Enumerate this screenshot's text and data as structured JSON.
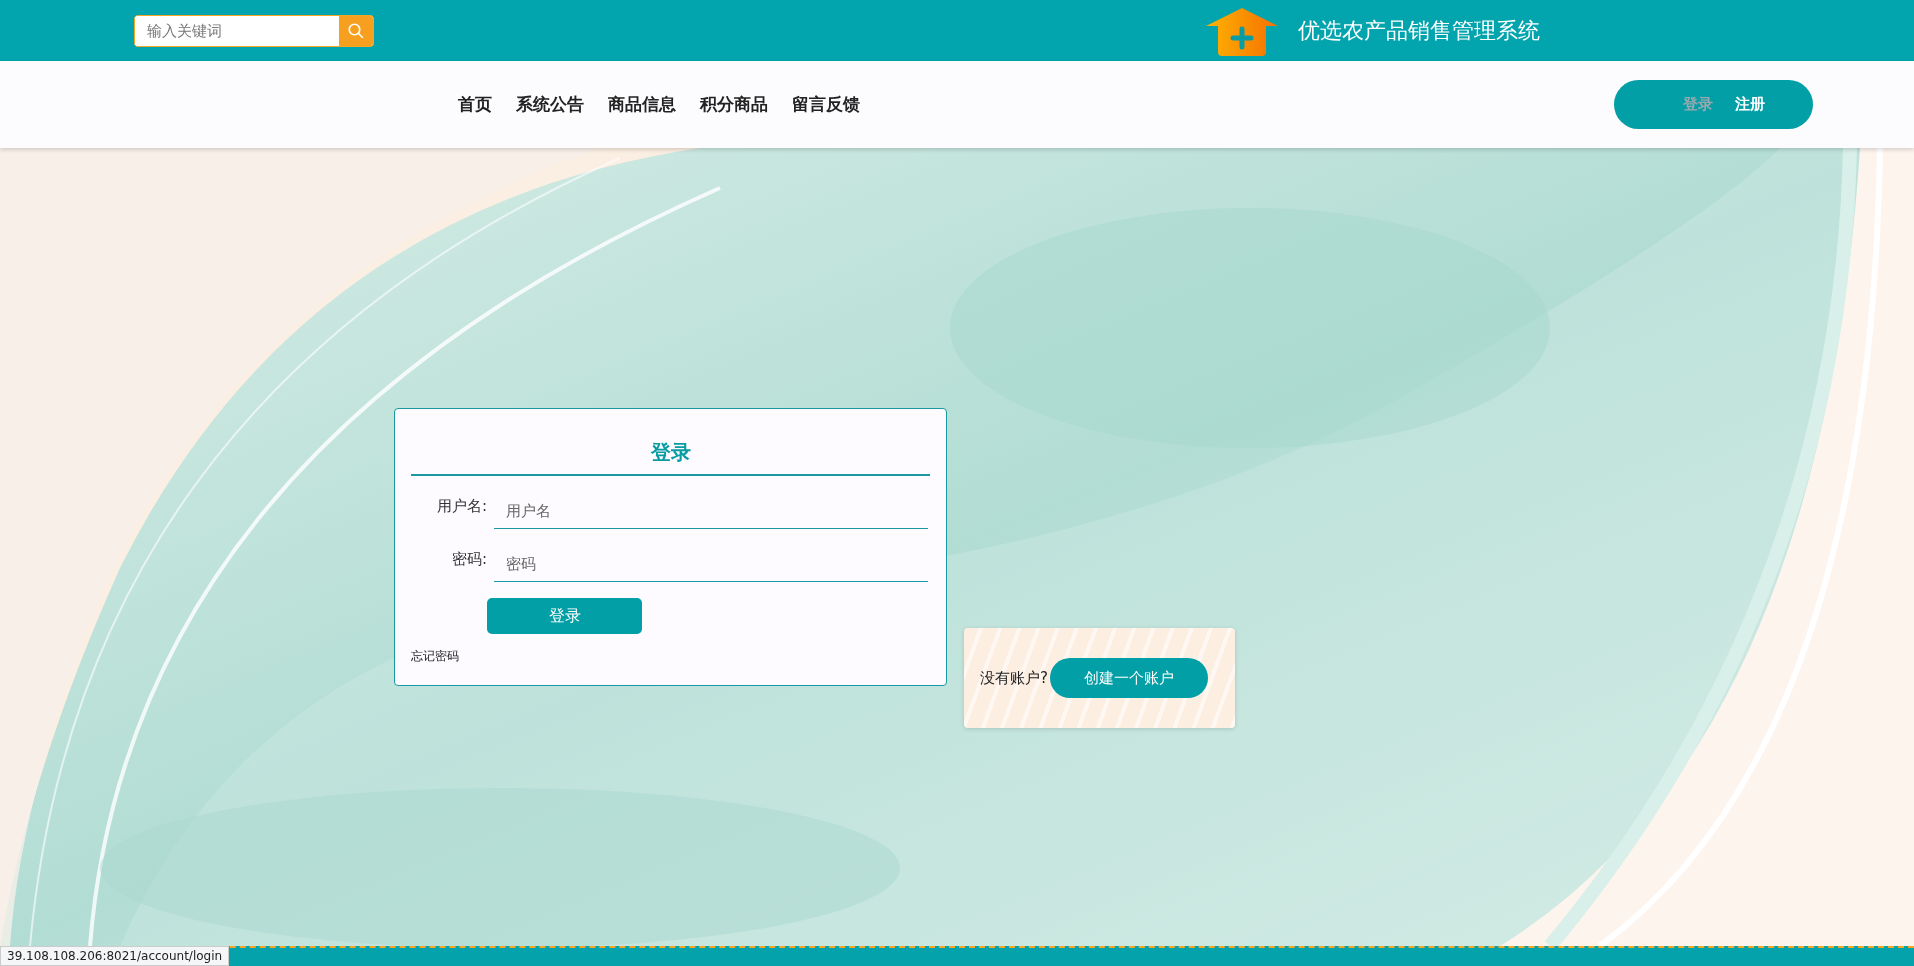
{
  "header": {
    "search": {
      "placeholder": "输入关键词"
    },
    "title": "优选农产品销售管理系统"
  },
  "nav": {
    "items": [
      {
        "label": "首页"
      },
      {
        "label": "系统公告"
      },
      {
        "label": "商品信息"
      },
      {
        "label": "积分商品"
      },
      {
        "label": "留言反馈"
      }
    ],
    "auth": {
      "login": "登录",
      "register": "注册"
    }
  },
  "login_card": {
    "title": "登录",
    "fields": [
      {
        "label": "用户名:",
        "placeholder": "用户名"
      },
      {
        "label": "密码:",
        "placeholder": "密码"
      }
    ],
    "submit": "登录",
    "forgot": "忘记密码"
  },
  "register_card": {
    "prompt": "没有账户?",
    "button": "创建一个账户"
  },
  "status_bar": {
    "url": "39.108.108.206:8021/account/login"
  }
}
